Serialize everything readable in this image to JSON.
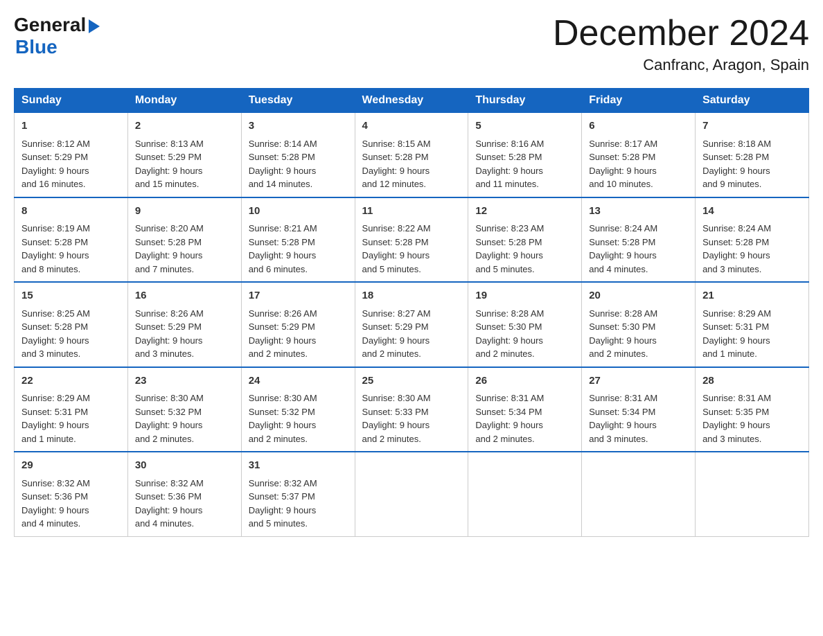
{
  "logo": {
    "general": "General",
    "blue": "Blue"
  },
  "title": "December 2024",
  "location": "Canfranc, Aragon, Spain",
  "days": [
    "Sunday",
    "Monday",
    "Tuesday",
    "Wednesday",
    "Thursday",
    "Friday",
    "Saturday"
  ],
  "weeks": [
    [
      {
        "day": "1",
        "sunrise": "8:12 AM",
        "sunset": "5:29 PM",
        "daylight": "9 hours and 16 minutes."
      },
      {
        "day": "2",
        "sunrise": "8:13 AM",
        "sunset": "5:29 PM",
        "daylight": "9 hours and 15 minutes."
      },
      {
        "day": "3",
        "sunrise": "8:14 AM",
        "sunset": "5:28 PM",
        "daylight": "9 hours and 14 minutes."
      },
      {
        "day": "4",
        "sunrise": "8:15 AM",
        "sunset": "5:28 PM",
        "daylight": "9 hours and 12 minutes."
      },
      {
        "day": "5",
        "sunrise": "8:16 AM",
        "sunset": "5:28 PM",
        "daylight": "9 hours and 11 minutes."
      },
      {
        "day": "6",
        "sunrise": "8:17 AM",
        "sunset": "5:28 PM",
        "daylight": "9 hours and 10 minutes."
      },
      {
        "day": "7",
        "sunrise": "8:18 AM",
        "sunset": "5:28 PM",
        "daylight": "9 hours and 9 minutes."
      }
    ],
    [
      {
        "day": "8",
        "sunrise": "8:19 AM",
        "sunset": "5:28 PM",
        "daylight": "9 hours and 8 minutes."
      },
      {
        "day": "9",
        "sunrise": "8:20 AM",
        "sunset": "5:28 PM",
        "daylight": "9 hours and 7 minutes."
      },
      {
        "day": "10",
        "sunrise": "8:21 AM",
        "sunset": "5:28 PM",
        "daylight": "9 hours and 6 minutes."
      },
      {
        "day": "11",
        "sunrise": "8:22 AM",
        "sunset": "5:28 PM",
        "daylight": "9 hours and 5 minutes."
      },
      {
        "day": "12",
        "sunrise": "8:23 AM",
        "sunset": "5:28 PM",
        "daylight": "9 hours and 5 minutes."
      },
      {
        "day": "13",
        "sunrise": "8:24 AM",
        "sunset": "5:28 PM",
        "daylight": "9 hours and 4 minutes."
      },
      {
        "day": "14",
        "sunrise": "8:24 AM",
        "sunset": "5:28 PM",
        "daylight": "9 hours and 3 minutes."
      }
    ],
    [
      {
        "day": "15",
        "sunrise": "8:25 AM",
        "sunset": "5:28 PM",
        "daylight": "9 hours and 3 minutes."
      },
      {
        "day": "16",
        "sunrise": "8:26 AM",
        "sunset": "5:29 PM",
        "daylight": "9 hours and 3 minutes."
      },
      {
        "day": "17",
        "sunrise": "8:26 AM",
        "sunset": "5:29 PM",
        "daylight": "9 hours and 2 minutes."
      },
      {
        "day": "18",
        "sunrise": "8:27 AM",
        "sunset": "5:29 PM",
        "daylight": "9 hours and 2 minutes."
      },
      {
        "day": "19",
        "sunrise": "8:28 AM",
        "sunset": "5:30 PM",
        "daylight": "9 hours and 2 minutes."
      },
      {
        "day": "20",
        "sunrise": "8:28 AM",
        "sunset": "5:30 PM",
        "daylight": "9 hours and 2 minutes."
      },
      {
        "day": "21",
        "sunrise": "8:29 AM",
        "sunset": "5:31 PM",
        "daylight": "9 hours and 1 minute."
      }
    ],
    [
      {
        "day": "22",
        "sunrise": "8:29 AM",
        "sunset": "5:31 PM",
        "daylight": "9 hours and 1 minute."
      },
      {
        "day": "23",
        "sunrise": "8:30 AM",
        "sunset": "5:32 PM",
        "daylight": "9 hours and 2 minutes."
      },
      {
        "day": "24",
        "sunrise": "8:30 AM",
        "sunset": "5:32 PM",
        "daylight": "9 hours and 2 minutes."
      },
      {
        "day": "25",
        "sunrise": "8:30 AM",
        "sunset": "5:33 PM",
        "daylight": "9 hours and 2 minutes."
      },
      {
        "day": "26",
        "sunrise": "8:31 AM",
        "sunset": "5:34 PM",
        "daylight": "9 hours and 2 minutes."
      },
      {
        "day": "27",
        "sunrise": "8:31 AM",
        "sunset": "5:34 PM",
        "daylight": "9 hours and 3 minutes."
      },
      {
        "day": "28",
        "sunrise": "8:31 AM",
        "sunset": "5:35 PM",
        "daylight": "9 hours and 3 minutes."
      }
    ],
    [
      {
        "day": "29",
        "sunrise": "8:32 AM",
        "sunset": "5:36 PM",
        "daylight": "9 hours and 4 minutes."
      },
      {
        "day": "30",
        "sunrise": "8:32 AM",
        "sunset": "5:36 PM",
        "daylight": "9 hours and 4 minutes."
      },
      {
        "day": "31",
        "sunrise": "8:32 AM",
        "sunset": "5:37 PM",
        "daylight": "9 hours and 5 minutes."
      },
      null,
      null,
      null,
      null
    ]
  ],
  "labels": {
    "sunrise": "Sunrise:",
    "sunset": "Sunset:",
    "daylight": "Daylight:"
  }
}
